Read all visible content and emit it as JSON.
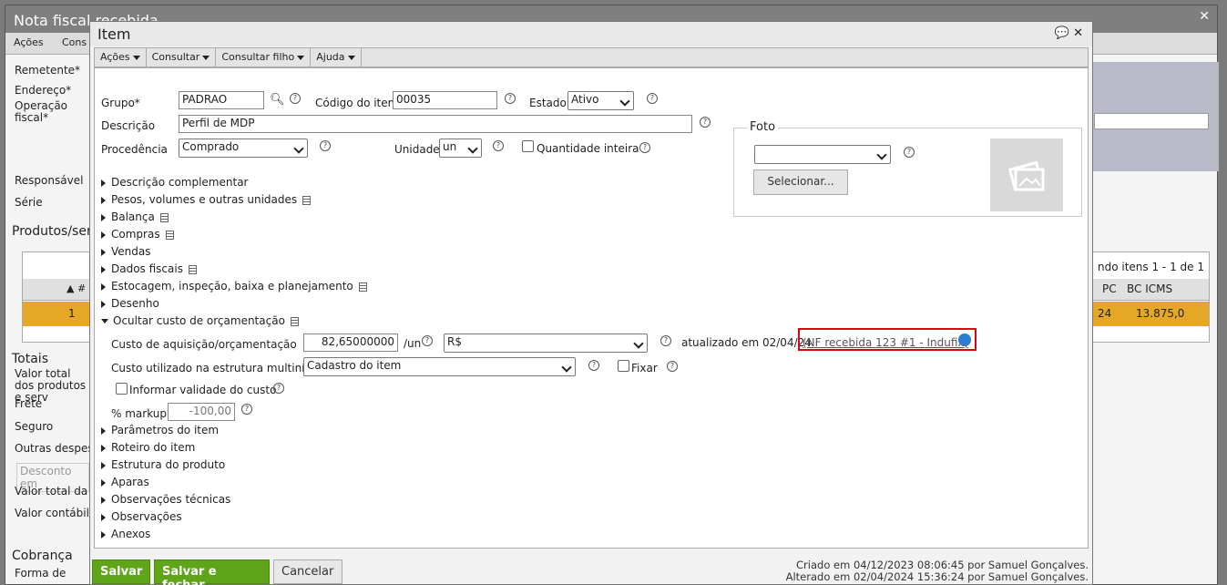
{
  "background": {
    "title": "Nota fiscal recebida",
    "menu": [
      "Ações",
      "Cons"
    ],
    "labels": {
      "remetente": "Remetente*",
      "endereco": "Endereço*",
      "operacao": "Operação fiscal*",
      "responsavel": "Responsável",
      "serie": "Série",
      "produtos": "Produtos/serv",
      "totais": "Totais",
      "valor_total": "Valor total dos produtos e serv",
      "frete": "Frete",
      "seguro": "Seguro",
      "outras": "Outras despesa",
      "desconto": "Desconto em",
      "valor_total_nota": "Valor total da n",
      "valor_contabil": "Valor contábil",
      "cobranca": "Cobrança",
      "forma": "Forma de"
    },
    "table": {
      "paging": "ndo itens 1 - 1 de 1",
      "headers": [
        "▲ #",
        "PC",
        "BC ICMS"
      ],
      "row": {
        "num": "1",
        "pc": "24",
        "bc_icms": "13.875,0"
      }
    }
  },
  "modal": {
    "title": "Item",
    "menu": [
      {
        "label": "Ações"
      },
      {
        "label": "Consultar"
      },
      {
        "label": "Consultar filho"
      },
      {
        "label": "Ajuda"
      }
    ],
    "fields": {
      "grupo_label": "Grupo*",
      "grupo_value": "PADRAO",
      "codigo_label": "Código do item",
      "codigo_value": "00035",
      "estado_label": "Estado",
      "estado_value": "Ativo",
      "descricao_label": "Descrição",
      "descricao_value": "Perfil de MDP",
      "procedencia_label": "Procedência",
      "procedencia_value": "Comprado",
      "unidade_label": "Unidade",
      "unidade_value": "un",
      "qtd_inteira_label": "Quantidade inteira"
    },
    "foto": {
      "legend": "Foto",
      "select_value": "",
      "button": "Selecionar..."
    },
    "sections": [
      {
        "label": "Descrição complementar",
        "doc": false
      },
      {
        "label": "Pesos, volumes e outras unidades",
        "doc": true
      },
      {
        "label": "Balança",
        "doc": true
      },
      {
        "label": "Compras",
        "doc": true
      },
      {
        "label": "Vendas",
        "doc": false
      },
      {
        "label": "Dados fiscais",
        "doc": true
      },
      {
        "label": "Estocagem, inspeção, baixa e planejamento",
        "doc": true
      },
      {
        "label": "Desenho",
        "doc": false
      }
    ],
    "custo": {
      "section_label": "Ocultar custo de orçamentação",
      "aquisicao_label": "Custo de aquisição/orçamentação",
      "aquisicao_value": "82,65000000",
      "per_un": "/un",
      "moeda": "R$",
      "atualizado": "atualizado em 02/04/24",
      "link": "(NF recebida 123 #1 - Indufix)",
      "estrutura_label": "Custo utilizado na estrutura multinível",
      "estrutura_value": "Cadastro do item",
      "fixar_label": "Fixar",
      "validade_label": "Informar validade do custo",
      "markup_label": "% markup",
      "markup_value": "-100,00"
    },
    "sections_after": [
      {
        "label": "Parâmetros do item"
      },
      {
        "label": "Roteiro do item"
      },
      {
        "label": "Estrutura do produto"
      },
      {
        "label": "Aparas"
      },
      {
        "label": "Observações técnicas"
      },
      {
        "label": "Observações"
      },
      {
        "label": "Anexos"
      }
    ],
    "buttons": {
      "salvar": "Salvar",
      "salvar_fechar": "Salvar e fechar",
      "cancelar": "Cancelar"
    },
    "meta": {
      "criado": "Criado em 04/12/2023 08:06:45 por Samuel Gonçalves.",
      "alterado": "Alterado em 02/04/2024 15:36:24 por Samuel Gonçalves."
    }
  }
}
